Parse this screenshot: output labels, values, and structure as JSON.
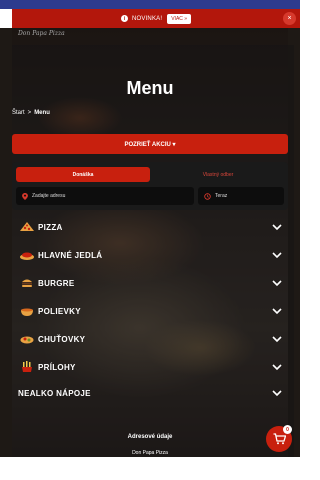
{
  "notice": {
    "text": "NOVINKA!",
    "more_label": "VIAC »",
    "close_label": "×"
  },
  "logo_text": "Don Papa Pizza",
  "page": {
    "title": "Menu"
  },
  "breadcrumb": {
    "home": "Štart",
    "separator": ">",
    "current": "Menu"
  },
  "promo_button": {
    "label": "POZRIEŤ AKCIU ▾"
  },
  "order": {
    "tab_delivery": "Donáška",
    "tab_pickup": "Vlastný odber",
    "address_placeholder": "Zadajte adresu",
    "time_value": "Teraz"
  },
  "categories": [
    {
      "label": "PIZZA",
      "icon": "pizza-icon"
    },
    {
      "label": "HLAVNÉ JEDLÁ",
      "icon": "main-dish-icon"
    },
    {
      "label": "BURGRE",
      "icon": "burger-icon"
    },
    {
      "label": "POLIEVKY",
      "icon": "soup-icon"
    },
    {
      "label": "CHUŤOVKY",
      "icon": "snack-icon"
    },
    {
      "label": "PRÍLOHY",
      "icon": "side-dish-icon"
    },
    {
      "label": "NEALKO  NÁPOJE",
      "icon": ""
    }
  ],
  "footer": {
    "address_title": "Adresové údaje",
    "name": "Don Papa Pizza"
  },
  "cart": {
    "count": "0"
  },
  "colors": {
    "accent": "#c8200e",
    "banner": "#b3170c",
    "top_strip": "#2d3b8e"
  }
}
